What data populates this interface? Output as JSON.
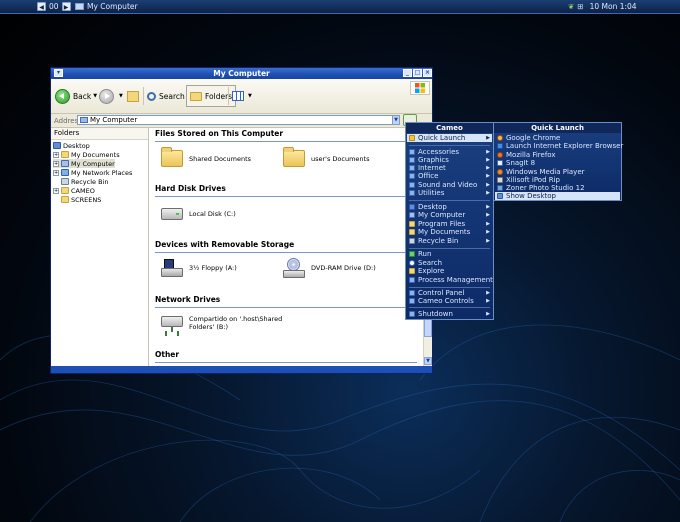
{
  "top_panel": {
    "workspace": "00",
    "window_title": "My Computer",
    "clock": "10 Mon 1:04"
  },
  "explorer": {
    "title": "My Computer",
    "toolbar": {
      "back_label": "Back",
      "search_label": "Search",
      "folders_label": "Folders"
    },
    "address": {
      "label": "Address",
      "value": "My Computer"
    },
    "folders_pane": {
      "title": "Folders",
      "items": [
        {
          "label": "Desktop",
          "expander": "−"
        },
        {
          "label": "My Documents",
          "expander": "+"
        },
        {
          "label": "My Computer",
          "expander": "+"
        },
        {
          "label": "My Network Places",
          "expander": "+"
        },
        {
          "label": "Recycle Bin",
          "expander": ""
        },
        {
          "label": "CAMEO",
          "expander": "+"
        },
        {
          "label": "SCREENS",
          "expander": ""
        }
      ]
    },
    "groups": [
      {
        "title": "Files Stored on This Computer",
        "items": [
          "Shared Documents",
          "user's Documents"
        ]
      },
      {
        "title": "Hard Disk Drives",
        "items": [
          "Local Disk (C:)"
        ]
      },
      {
        "title": "Devices with Removable Storage",
        "items": [
          "3½ Floppy (A:)",
          "DVD-RAM Drive (D:)"
        ]
      },
      {
        "title": "Network Drives",
        "items": [
          "Compartido on '.host\\Shared Folders' (B:)"
        ]
      },
      {
        "title": "Other",
        "items": []
      }
    ]
  },
  "cameo_menu": {
    "title": "Cameo",
    "items": [
      {
        "label": "Quick Launch",
        "submenu": true
      },
      {
        "label": "Accessories",
        "submenu": true
      },
      {
        "label": "Graphics",
        "submenu": true
      },
      {
        "label": "Internet",
        "submenu": true
      },
      {
        "label": "Office",
        "submenu": true
      },
      {
        "label": "Sound and Video",
        "submenu": true
      },
      {
        "label": "Utilities",
        "submenu": true
      },
      {
        "label": "Desktop",
        "submenu": true
      },
      {
        "label": "My Computer",
        "submenu": true
      },
      {
        "label": "Program Files",
        "submenu": true
      },
      {
        "label": "My Documents",
        "submenu": true
      },
      {
        "label": "Recycle Bin",
        "submenu": true
      },
      {
        "label": "Run",
        "submenu": false
      },
      {
        "label": "Search",
        "submenu": false
      },
      {
        "label": "Explore",
        "submenu": false
      },
      {
        "label": "Process Management",
        "submenu": false
      },
      {
        "label": "Control Panel",
        "submenu": true
      },
      {
        "label": "Cameo Controls",
        "submenu": true
      },
      {
        "label": "Shutdown",
        "submenu": true
      }
    ]
  },
  "quick_launch": {
    "title": "Quick Launch",
    "items": [
      "Google Chrome",
      "Launch Internet Explorer Browser",
      "Mozilla Firefox",
      "SnagIt 8",
      "Windows Media Player",
      "Xilisoft iPod Rip",
      "Zoner Photo Studio 12",
      "Show Desktop"
    ]
  },
  "colors": {
    "menu_bg": "#1a3f80",
    "menu_highlight": "#d7e3f6",
    "title_blue": "#1d4fb4"
  }
}
